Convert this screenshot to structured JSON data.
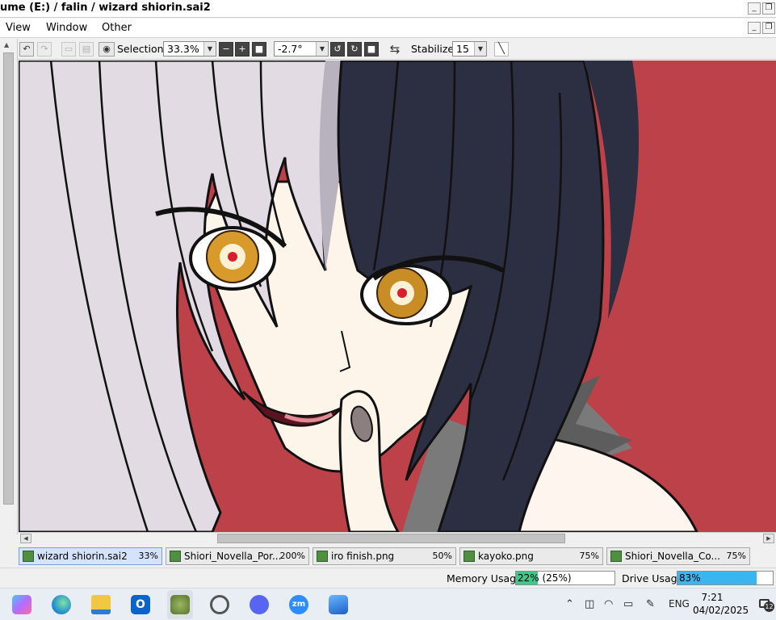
{
  "window": {
    "title": "ume (E:) / falin / wizard shiorin.sai2"
  },
  "menu": {
    "items": [
      {
        "label": "View"
      },
      {
        "label": "Window"
      },
      {
        "label": "Other"
      }
    ]
  },
  "toolbar": {
    "selection_label": "Selection",
    "zoom_value": "33.3%",
    "rotation_value": "-2.7°",
    "stabilizer_label": "Stabilizer",
    "stabilizer_value": "15"
  },
  "tabs": [
    {
      "name": "wizard shiorin.sai2",
      "zoom": "33%",
      "active": true
    },
    {
      "name": "Shiori_Novella_Por...",
      "zoom": "200%",
      "active": false
    },
    {
      "name": "iro finish.png",
      "zoom": "50%",
      "active": false
    },
    {
      "name": "kayoko.png",
      "zoom": "75%",
      "active": false
    },
    {
      "name": "Shiori_Novella_Co...",
      "zoom": "75%",
      "active": false
    }
  ],
  "status": {
    "memory_label": "Memory Usage",
    "memory_text": "22% (25%)",
    "memory_fraction": 0.22,
    "drive_label": "Drive Usage",
    "drive_text": "83%",
    "drive_fraction": 0.83
  },
  "taskbar": {
    "apps": [
      "copilot-icon",
      "edge-icon",
      "file-explorer-icon",
      "outlook-icon",
      "paint-tool-sai-icon",
      "chatgpt-icon",
      "discord-icon",
      "zoom-icon",
      "photos-icon"
    ],
    "language": "ENG",
    "time": "7:21",
    "date": "04/02/2025",
    "notification_count": "12"
  },
  "colors": {
    "canvas_background": "#bd4149",
    "memory_fill": "#3ec88a",
    "drive_fill": "#39b6ef",
    "active_tab": "#d4e2fb"
  }
}
